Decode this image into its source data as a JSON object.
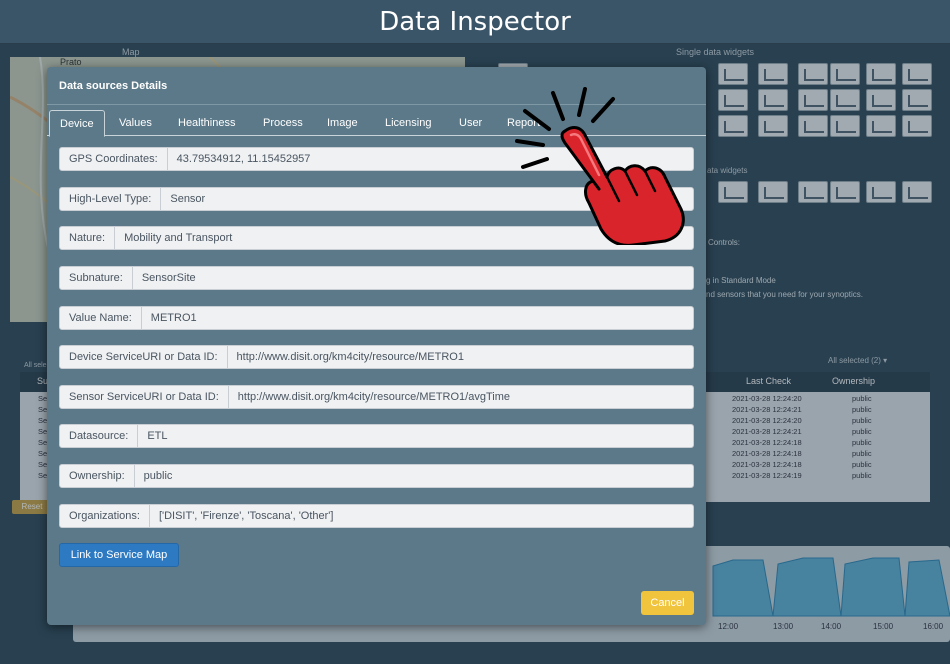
{
  "app": {
    "title": "Data Inspector",
    "map_label": "Map",
    "map_town": "Prato",
    "single_widgets_label": "Single data widgets",
    "multi_widgets_label": "ata widgets",
    "note_controls": "Controls:",
    "note_mode": "g in Standard Mode",
    "note_sensors": "nd sensors that you need for your synoptics.",
    "selected_left": "All sele",
    "selected_right": "All selected (2) ▾",
    "reset_label": "Reset",
    "table_headers": {
      "subnature": "Su",
      "last_check": "Last Check",
      "ownership": "Ownership"
    },
    "table_rows": [
      {
        "prefix": "Se",
        "last_check": "2021-03-28 12:24:20",
        "ownership": "public"
      },
      {
        "prefix": "Se",
        "last_check": "2021-03-28 12:24:21",
        "ownership": "public"
      },
      {
        "prefix": "Se",
        "last_check": "2021-03-28 12:24:20",
        "ownership": "public"
      },
      {
        "prefix": "Se",
        "last_check": "2021-03-28 12:24:21",
        "ownership": "public"
      },
      {
        "prefix": "Se",
        "last_check": "2021-03-28 12:24:18",
        "ownership": "public"
      },
      {
        "prefix": "Se",
        "last_check": "2021-03-28 12:24:18",
        "ownership": "public"
      },
      {
        "prefix": "Se",
        "last_check": "2021-03-28 12:24:18",
        "ownership": "public"
      },
      {
        "prefix": "Se",
        "last_check": "2021-03-28 12:24:19",
        "ownership": "public"
      }
    ],
    "chart_xticks": [
      "12:00",
      "13:00",
      "14:00",
      "15:00",
      "16:00"
    ]
  },
  "modal": {
    "title": "Data sources Details",
    "tabs": [
      "Device",
      "Values",
      "Healthiness",
      "Process",
      "Image",
      "Licensing",
      "User",
      "Report"
    ],
    "active_tab": "Device",
    "fields": [
      {
        "label": "GPS Coordinates:",
        "value": "43.79534912, 11.15452957"
      },
      {
        "label": "High-Level Type:",
        "value": "Sensor"
      },
      {
        "label": "Nature:",
        "value": "Mobility and Transport"
      },
      {
        "label": "Subnature:",
        "value": "SensorSite"
      },
      {
        "label": "Value Name:",
        "value": "METRO1"
      },
      {
        "label": "Device ServiceURI or Data ID:",
        "value": "http://www.disit.org/km4city/resource/METRO1"
      },
      {
        "label": "Sensor ServiceURI or Data ID:",
        "value": "http://www.disit.org/km4city/resource/METRO1/avgTime"
      },
      {
        "label": "Datasource:",
        "value": "ETL"
      },
      {
        "label": "Ownership:",
        "value": "public"
      },
      {
        "label": "Organizations:",
        "value": "['DISIT', 'Firenze', 'Toscana', 'Other']"
      }
    ],
    "link_button": "Link to Service Map",
    "cancel_button": "Cancel"
  },
  "colors": {
    "modal_bg": "#5c7989",
    "link_button": "#2e7ac2",
    "cancel_button": "#f0c43c",
    "hand": "#d9242b"
  },
  "icons": {
    "hand": "pointing-hand-icon"
  }
}
